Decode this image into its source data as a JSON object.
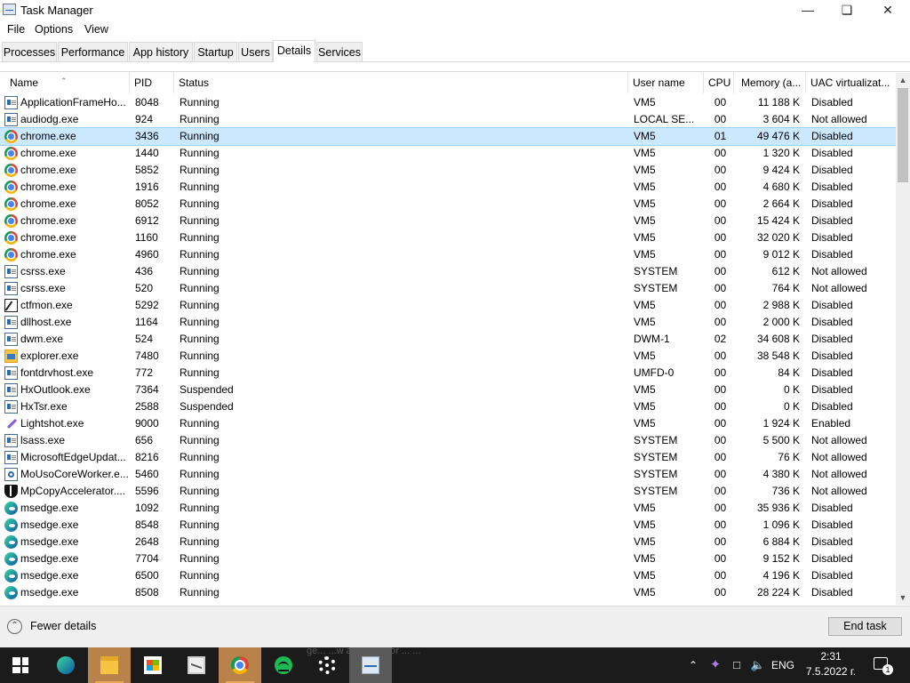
{
  "window": {
    "title": "Task Manager"
  },
  "menu": [
    "File",
    "Options",
    "View"
  ],
  "tabs": [
    "Processes",
    "Performance",
    "App history",
    "Startup",
    "Users",
    "Details",
    "Services"
  ],
  "active_tab": "Details",
  "columns": {
    "name": "Name",
    "pid": "PID",
    "status": "Status",
    "user": "User name",
    "cpu": "CPU",
    "memory": "Memory (a...",
    "uac": "UAC virtualizat..."
  },
  "selected_row_index": 2,
  "rows": [
    {
      "icon": "window-icon",
      "name": "ApplicationFrameHo...",
      "pid": "8048",
      "status": "Running",
      "user": "VM5",
      "cpu": "00",
      "memory": "11 188 K",
      "uac": "Disabled"
    },
    {
      "icon": "window-icon",
      "name": "audiodg.exe",
      "pid": "924",
      "status": "Running",
      "user": "LOCAL SE...",
      "cpu": "00",
      "memory": "3 604 K",
      "uac": "Not allowed"
    },
    {
      "icon": "chrome-icon",
      "name": "chrome.exe",
      "pid": "3436",
      "status": "Running",
      "user": "VM5",
      "cpu": "01",
      "memory": "49 476 K",
      "uac": "Disabled"
    },
    {
      "icon": "chrome-icon",
      "name": "chrome.exe",
      "pid": "1440",
      "status": "Running",
      "user": "VM5",
      "cpu": "00",
      "memory": "1 320 K",
      "uac": "Disabled"
    },
    {
      "icon": "chrome-icon",
      "name": "chrome.exe",
      "pid": "5852",
      "status": "Running",
      "user": "VM5",
      "cpu": "00",
      "memory": "9 424 K",
      "uac": "Disabled"
    },
    {
      "icon": "chrome-icon",
      "name": "chrome.exe",
      "pid": "1916",
      "status": "Running",
      "user": "VM5",
      "cpu": "00",
      "memory": "4 680 K",
      "uac": "Disabled"
    },
    {
      "icon": "chrome-icon",
      "name": "chrome.exe",
      "pid": "8052",
      "status": "Running",
      "user": "VM5",
      "cpu": "00",
      "memory": "2 664 K",
      "uac": "Disabled"
    },
    {
      "icon": "chrome-icon",
      "name": "chrome.exe",
      "pid": "6912",
      "status": "Running",
      "user": "VM5",
      "cpu": "00",
      "memory": "15 424 K",
      "uac": "Disabled"
    },
    {
      "icon": "chrome-icon",
      "name": "chrome.exe",
      "pid": "1160",
      "status": "Running",
      "user": "VM5",
      "cpu": "00",
      "memory": "32 020 K",
      "uac": "Disabled"
    },
    {
      "icon": "chrome-icon",
      "name": "chrome.exe",
      "pid": "4960",
      "status": "Running",
      "user": "VM5",
      "cpu": "00",
      "memory": "9 012 K",
      "uac": "Disabled"
    },
    {
      "icon": "window-icon",
      "name": "csrss.exe",
      "pid": "436",
      "status": "Running",
      "user": "SYSTEM",
      "cpu": "00",
      "memory": "612 K",
      "uac": "Not allowed"
    },
    {
      "icon": "window-icon",
      "name": "csrss.exe",
      "pid": "520",
      "status": "Running",
      "user": "SYSTEM",
      "cpu": "00",
      "memory": "764 K",
      "uac": "Not allowed"
    },
    {
      "icon": "ctfmon-icon",
      "name": "ctfmon.exe",
      "pid": "5292",
      "status": "Running",
      "user": "VM5",
      "cpu": "00",
      "memory": "2 988 K",
      "uac": "Disabled"
    },
    {
      "icon": "window-icon",
      "name": "dllhost.exe",
      "pid": "1164",
      "status": "Running",
      "user": "VM5",
      "cpu": "00",
      "memory": "2 000 K",
      "uac": "Disabled"
    },
    {
      "icon": "window-icon",
      "name": "dwm.exe",
      "pid": "524",
      "status": "Running",
      "user": "DWM-1",
      "cpu": "02",
      "memory": "34 608 K",
      "uac": "Disabled"
    },
    {
      "icon": "folder-icon",
      "name": "explorer.exe",
      "pid": "7480",
      "status": "Running",
      "user": "VM5",
      "cpu": "00",
      "memory": "38 548 K",
      "uac": "Disabled"
    },
    {
      "icon": "window-icon",
      "name": "fontdrvhost.exe",
      "pid": "772",
      "status": "Running",
      "user": "UMFD-0",
      "cpu": "00",
      "memory": "84 K",
      "uac": "Disabled"
    },
    {
      "icon": "window-icon",
      "name": "HxOutlook.exe",
      "pid": "7364",
      "status": "Suspended",
      "user": "VM5",
      "cpu": "00",
      "memory": "0 K",
      "uac": "Disabled"
    },
    {
      "icon": "window-icon",
      "name": "HxTsr.exe",
      "pid": "2588",
      "status": "Suspended",
      "user": "VM5",
      "cpu": "00",
      "memory": "0 K",
      "uac": "Disabled"
    },
    {
      "icon": "lightshot-icon",
      "name": "Lightshot.exe",
      "pid": "9000",
      "status": "Running",
      "user": "VM5",
      "cpu": "00",
      "memory": "1 924 K",
      "uac": "Enabled"
    },
    {
      "icon": "window-icon",
      "name": "lsass.exe",
      "pid": "656",
      "status": "Running",
      "user": "SYSTEM",
      "cpu": "00",
      "memory": "5 500 K",
      "uac": "Not allowed"
    },
    {
      "icon": "window-icon",
      "name": "MicrosoftEdgeUpdat...",
      "pid": "8216",
      "status": "Running",
      "user": "SYSTEM",
      "cpu": "00",
      "memory": "76 K",
      "uac": "Not allowed"
    },
    {
      "icon": "gear-icon",
      "name": "MoUsoCoreWorker.e...",
      "pid": "5460",
      "status": "Running",
      "user": "SYSTEM",
      "cpu": "00",
      "memory": "4 380 K",
      "uac": "Not allowed"
    },
    {
      "icon": "shield-icon",
      "name": "MpCopyAccelerator....",
      "pid": "5596",
      "status": "Running",
      "user": "SYSTEM",
      "cpu": "00",
      "memory": "736 K",
      "uac": "Not allowed"
    },
    {
      "icon": "edge-icon",
      "name": "msedge.exe",
      "pid": "1092",
      "status": "Running",
      "user": "VM5",
      "cpu": "00",
      "memory": "35 936 K",
      "uac": "Disabled"
    },
    {
      "icon": "edge-icon",
      "name": "msedge.exe",
      "pid": "8548",
      "status": "Running",
      "user": "VM5",
      "cpu": "00",
      "memory": "1 096 K",
      "uac": "Disabled"
    },
    {
      "icon": "edge-icon",
      "name": "msedge.exe",
      "pid": "2648",
      "status": "Running",
      "user": "VM5",
      "cpu": "00",
      "memory": "6 884 K",
      "uac": "Disabled"
    },
    {
      "icon": "edge-icon",
      "name": "msedge.exe",
      "pid": "7704",
      "status": "Running",
      "user": "VM5",
      "cpu": "00",
      "memory": "9 152 K",
      "uac": "Disabled"
    },
    {
      "icon": "edge-icon",
      "name": "msedge.exe",
      "pid": "6500",
      "status": "Running",
      "user": "VM5",
      "cpu": "00",
      "memory": "4 196 K",
      "uac": "Disabled"
    },
    {
      "icon": "edge-icon",
      "name": "msedge.exe",
      "pid": "8508",
      "status": "Running",
      "user": "VM5",
      "cpu": "00",
      "memory": "28 224 K",
      "uac": "Disabled"
    }
  ],
  "footer": {
    "fewer_details": "Fewer details",
    "end_task": "End task"
  },
  "taskbar": {
    "apps": [
      "start-icon",
      "edge-icon",
      "file-explorer-icon",
      "store-icon",
      "mail-icon",
      "chrome-icon",
      "spotify-icon",
      "settings-icon",
      "task-manager-icon"
    ],
    "background_text": "ge... ...w available for ... ...",
    "tray": {
      "language": "ENG",
      "time": "2:31",
      "date": "7.5.2022 г.",
      "notification_count": "1"
    }
  },
  "colors": {
    "selection": "#cce8ff",
    "taskbar": "#1b1b1b",
    "header_border": "#e5e5e5"
  }
}
